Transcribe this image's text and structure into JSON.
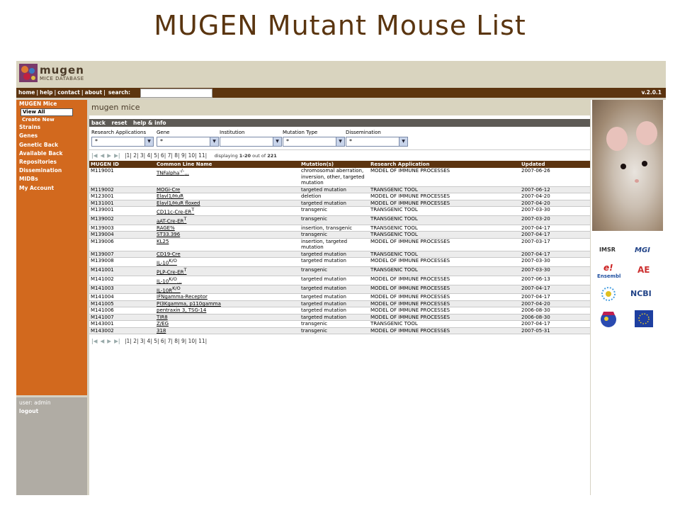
{
  "slide_title": "MUGEN Mutant Mouse List",
  "app": {
    "logo_text": "mugen",
    "logo_subtitle": "MICE DATABASE",
    "version": "v.2.0.1"
  },
  "topnav": {
    "items": [
      "home",
      "help",
      "contact",
      "about"
    ],
    "search_label": "search:",
    "search_value": ""
  },
  "leftnav": {
    "section": "MUGEN Mice",
    "view_all": "View All",
    "create_new": "Create New",
    "items": [
      "Strains",
      "Genes",
      "Genetic Back",
      "Available Back",
      "Repositories",
      "Dissemination",
      "MIDBs",
      "My Account"
    ]
  },
  "user": {
    "label": "user: admin",
    "logout": "logout"
  },
  "main": {
    "heading": "mugen mice",
    "actions": [
      "back",
      "reset",
      "help & info"
    ],
    "filters": [
      {
        "label": "Research Applications",
        "value": "*"
      },
      {
        "label": "Gene",
        "value": "*"
      },
      {
        "label": "Institution",
        "value": ""
      },
      {
        "label": "Mutation Type",
        "value": "*"
      },
      {
        "label": "Dissemination",
        "value": "*"
      }
    ],
    "pager": {
      "nav_first": "|◀",
      "nav_prev": "◀",
      "nav_next": "▶",
      "nav_last": "▶|",
      "pages_text": "|1| 2| 3| 4| 5| 6| 7| 8| 9| 10| 11|",
      "displaying_label": "displaying",
      "range": "1-20",
      "out_of_label": "out of",
      "total": "221"
    },
    "table": {
      "columns": [
        "MUGEN ID",
        "Common Line Name",
        "Mutation(s)",
        "Research Application",
        "Updated"
      ],
      "rows": [
        {
          "id": "M119001",
          "name": "TNFalpha",
          "sup": "-/-",
          "suffix": "...",
          "mutation": "chromosomal aberration, inversion, other, targeted mutation",
          "application": "MODEL OF IMMUNE PROCESSES",
          "updated": "2007-06-26"
        },
        {
          "id": "M119002",
          "name": "MOGi-Cre",
          "sup": "",
          "suffix": "",
          "mutation": "targeted mutation",
          "application": "TRANSGENIC TOOL",
          "updated": "2007-06-12"
        },
        {
          "id": "M123001",
          "name": "Elavl1/HuR",
          "sup": "",
          "suffix": "",
          "mutation": "deletion",
          "application": "MODEL OF IMMUNE PROCESSES",
          "updated": "2007-04-20"
        },
        {
          "id": "M131001",
          "name": "Elavl1/HuR floxed",
          "sup": "",
          "suffix": "",
          "mutation": "targeted mutation",
          "application": "MODEL OF IMMUNE PROCESSES",
          "updated": "2007-04-20"
        },
        {
          "id": "M139001",
          "name": "CD11c-Cre-ER",
          "sup": "T",
          "suffix": "",
          "mutation": "transgenic",
          "application": "TRANSGENIC TOOL",
          "updated": "2007-03-30"
        },
        {
          "id": "M139002",
          "name": "aAT-Cre-ER",
          "sup": "T",
          "suffix": "",
          "mutation": "transgenic",
          "application": "TRANSGENIC TOOL",
          "updated": "2007-03-20"
        },
        {
          "id": "M139003",
          "name": "RAGE%",
          "sup": "",
          "suffix": "",
          "mutation": "insertion, transgenic",
          "application": "TRANSGENIC TOOL",
          "updated": "2007-04-17"
        },
        {
          "id": "M139004",
          "name": "ST33.396",
          "sup": "",
          "suffix": "",
          "mutation": "transgenic",
          "application": "TRANSGENIC TOOL",
          "updated": "2007-04-17"
        },
        {
          "id": "M139006",
          "name": "KL25",
          "sup": "",
          "suffix": "",
          "mutation": "insertion, targeted mutation",
          "application": "MODEL OF IMMUNE PROCESSES",
          "updated": "2007-03-17"
        },
        {
          "id": "M139007",
          "name": "CD19-Cre",
          "sup": "",
          "suffix": "",
          "mutation": "targeted mutation",
          "application": "TRANSGENIC TOOL",
          "updated": "2007-04-17"
        },
        {
          "id": "M139008",
          "name": "IL-10",
          "sup": "K/O",
          "suffix": "",
          "mutation": "targeted mutation",
          "application": "MODEL OF IMMUNE PROCESSES",
          "updated": "2007-03-30"
        },
        {
          "id": "M141001",
          "name": "PLP-Cre-ER",
          "sup": "T",
          "suffix": "",
          "mutation": "transgenic",
          "application": "TRANSGENIC TOOL",
          "updated": "2007-03-30"
        },
        {
          "id": "M141002",
          "name": "IL-10",
          "sup": "K/O",
          "suffix": "...",
          "mutation": "targeted mutation",
          "application": "MODEL OF IMMUNE PROCESSES",
          "updated": "2007-06-13"
        },
        {
          "id": "M141003",
          "name": "IL-10R",
          "sup": "K/O",
          "suffix": "",
          "mutation": "targeted mutation",
          "application": "MODEL OF IMMUNE PROCESSES",
          "updated": "2007-04-17"
        },
        {
          "id": "M141004",
          "name": "IFNgamma-Receptor",
          "sup": "",
          "suffix": "",
          "mutation": "targeted mutation",
          "application": "MODEL OF IMMUNE PROCESSES",
          "updated": "2007-04-17"
        },
        {
          "id": "M141005",
          "name": "PI3Kgamma, p110gamma",
          "sup": "",
          "suffix": "",
          "mutation": "targeted mutation",
          "application": "MODEL OF IMMUNE PROCESSES",
          "updated": "2007-04-20"
        },
        {
          "id": "M141006",
          "name": "pentraxin 3, TSG-14",
          "sup": "",
          "suffix": "",
          "mutation": "targeted mutation",
          "application": "MODEL OF IMMUNE PROCESSES",
          "updated": "2006-08-30"
        },
        {
          "id": "M141007",
          "name": "TIR8",
          "sup": "",
          "suffix": "",
          "mutation": "targeted mutation",
          "application": "MODEL OF IMMUNE PROCESSES",
          "updated": "2006-08-30"
        },
        {
          "id": "M143001",
          "name": "Z/EG",
          "sup": "",
          "suffix": "",
          "mutation": "transgenic",
          "application": "TRANSGENIC TOOL",
          "updated": "2007-04-17"
        },
        {
          "id": "M143002",
          "name": "318",
          "sup": "",
          "suffix": "",
          "mutation": "transgenic",
          "application": "MODEL OF IMMUNE PROCESSES",
          "updated": "2007-05-31"
        }
      ]
    }
  },
  "partner_logos": [
    {
      "icon": "imsr-logo-icon",
      "text": "IMSR"
    },
    {
      "icon": "mgi-logo-icon",
      "text": "MGI"
    },
    {
      "icon": "ensembl-logo-icon",
      "text": "e!"
    },
    {
      "icon": "ensembl-logo-icon",
      "text": "Ensembl"
    },
    {
      "icon": "arrayexpress-logo-icon",
      "text": "AE"
    },
    {
      "icon": "dna-logo-icon",
      "text": ""
    },
    {
      "icon": "ncbi-logo-icon",
      "text": "NCBI"
    },
    {
      "icon": "globe-logo-icon",
      "text": ""
    },
    {
      "icon": "eu-flag-icon",
      "text": ""
    }
  ],
  "colors": {
    "title": "#5a3510",
    "nav_brown": "#5c3410",
    "sidebar_orange": "#d2691e",
    "frame_bg": "#d6d2c4"
  }
}
